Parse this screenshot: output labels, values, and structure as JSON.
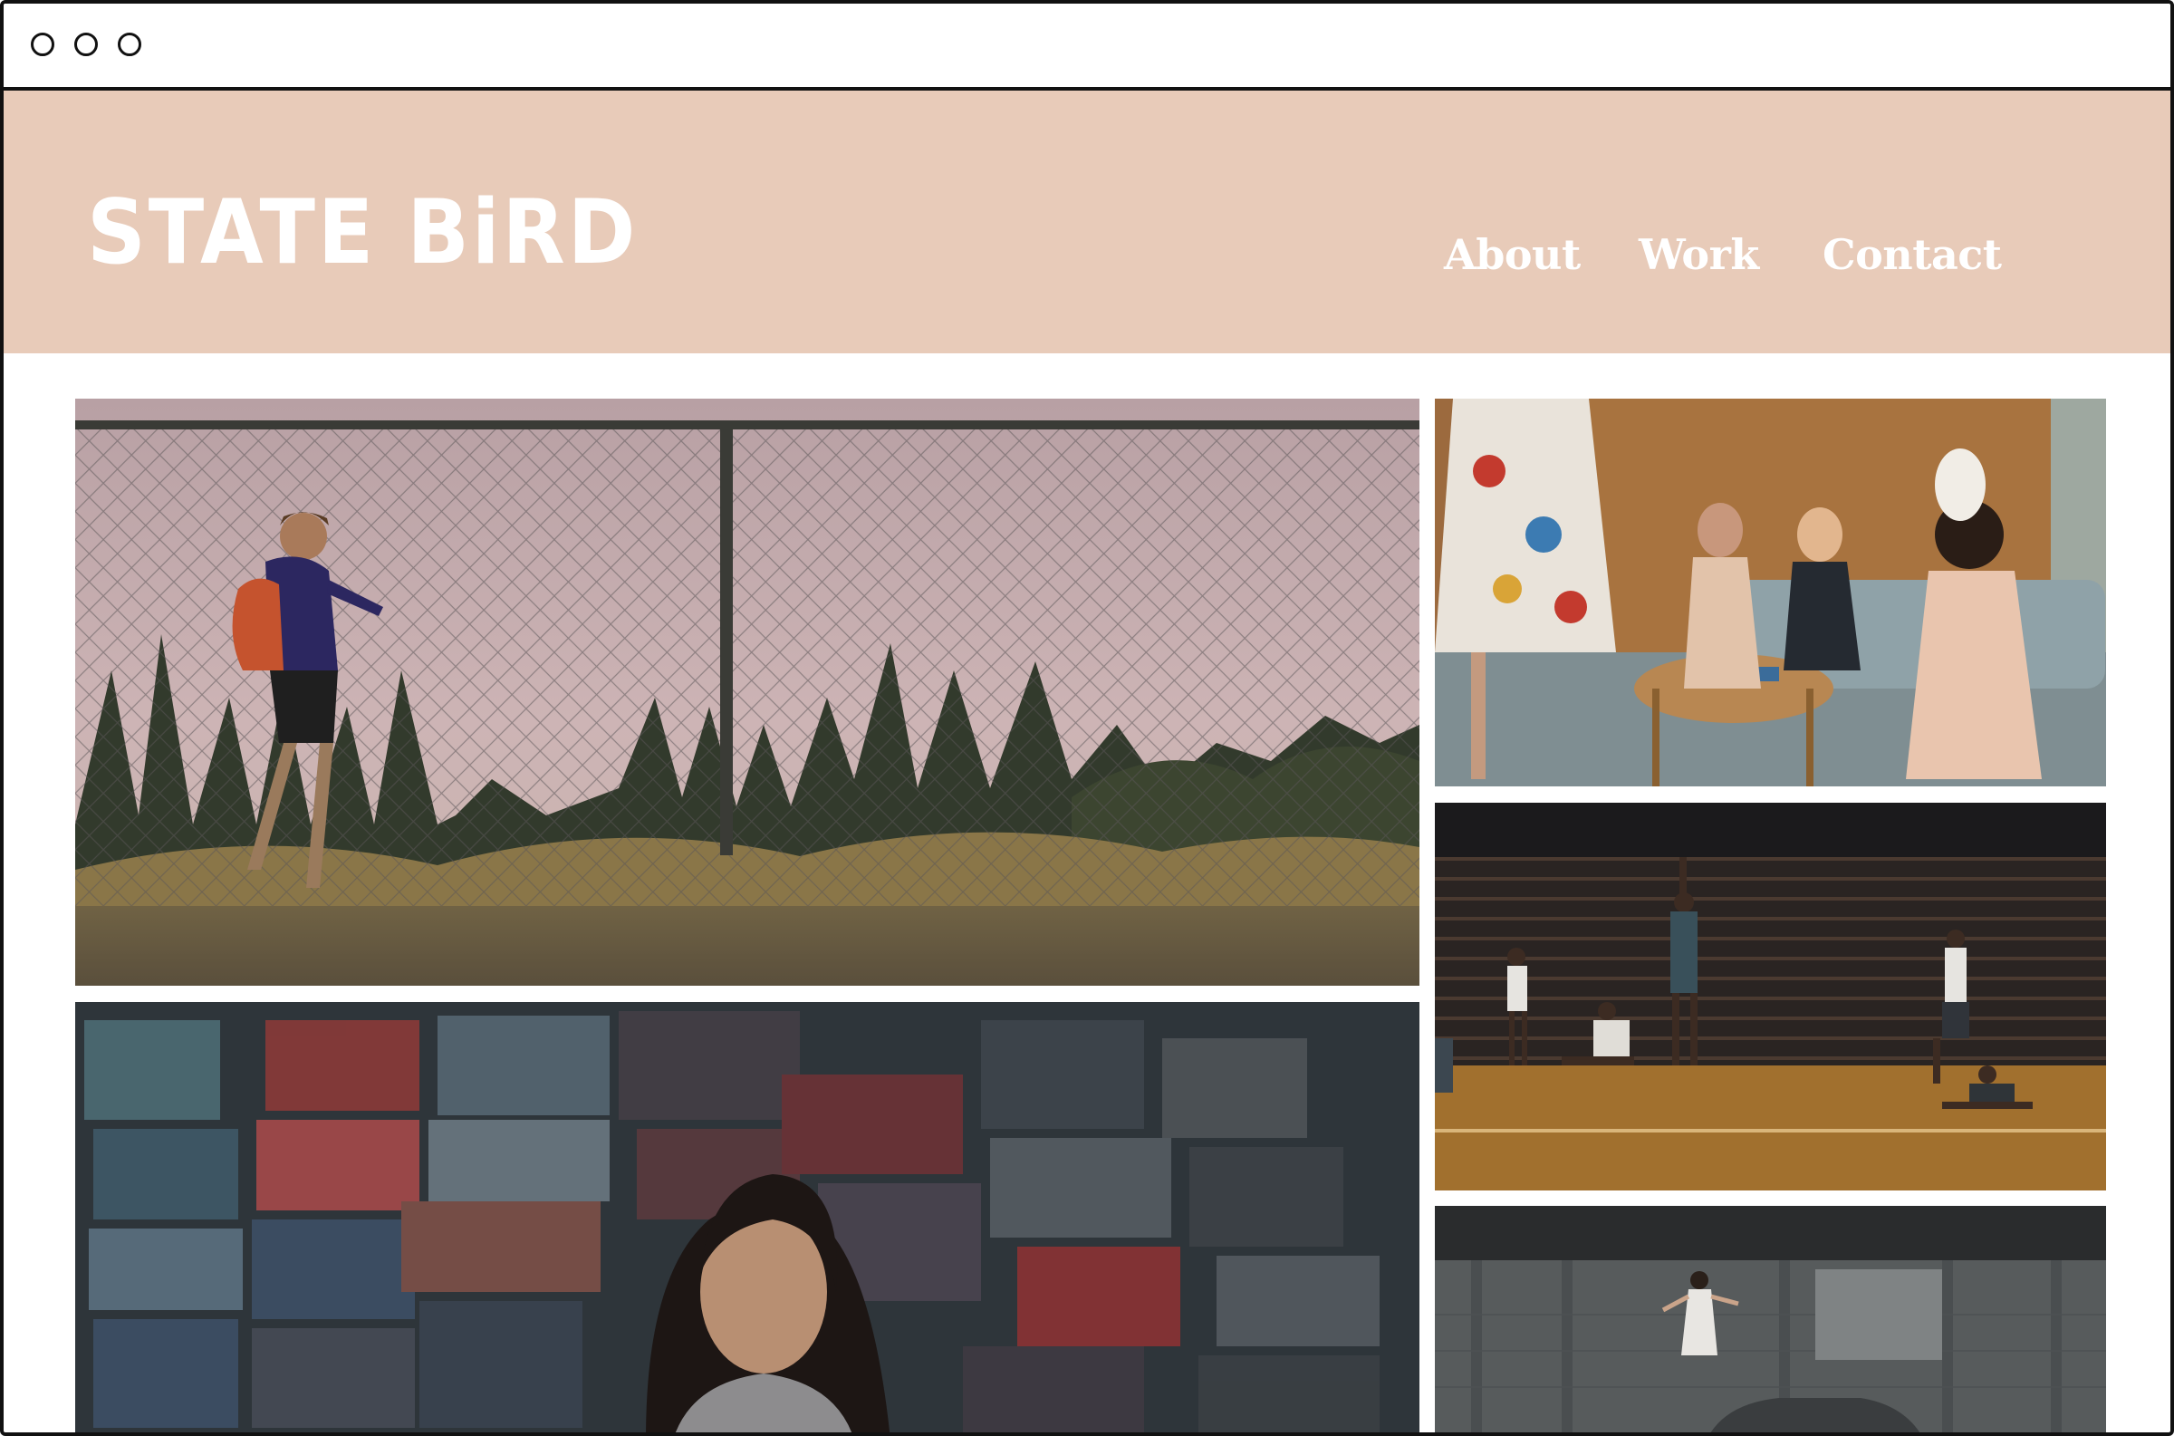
{
  "window": {
    "controls": [
      "window-control-dot",
      "window-control-dot",
      "window-control-dot"
    ]
  },
  "header": {
    "logo": "STATE BiRD",
    "nav": {
      "about": "About",
      "work": "Work",
      "contact": "Contact"
    },
    "background_color": "#e8cbb9"
  },
  "gallery": {
    "items": [
      {
        "name": "boy-running-by-fence"
      },
      {
        "name": "girl-at-magazine-rack"
      },
      {
        "name": "women-in-living-room"
      },
      {
        "name": "dancers-on-court"
      },
      {
        "name": "woman-floating-in-warehouse"
      }
    ]
  }
}
